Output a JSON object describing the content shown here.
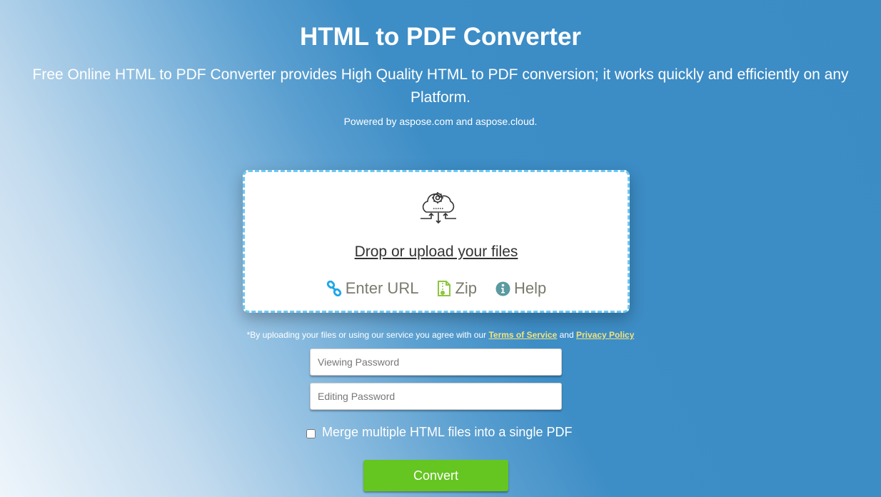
{
  "header": {
    "title": "HTML to PDF Converter",
    "subtitle": "Free Online HTML to PDF Converter provides High Quality HTML to PDF conversion; it works quickly and efficiently on any Platform.",
    "powered_by": "Powered by aspose.com and aspose.cloud."
  },
  "dropzone": {
    "icon": "cloud-upload-gear-icon",
    "upload_label": "Drop or upload your files",
    "options": [
      {
        "label": "Enter URL",
        "icon": "link-icon",
        "color": "#1ea7e8"
      },
      {
        "label": "Zip",
        "icon": "zip-file-icon",
        "color": "#8dc63f"
      },
      {
        "label": "Help",
        "icon": "info-icon",
        "color": "#5b9aa0"
      }
    ]
  },
  "terms": {
    "prefix": "*By uploading your files or using our service you agree with our",
    "terms_link": "Terms of Service",
    "and": "and",
    "privacy_link": "Privacy Policy"
  },
  "form": {
    "viewing_password_placeholder": "Viewing Password",
    "viewing_password_value": "",
    "editing_password_placeholder": "Editing Password",
    "editing_password_value": "",
    "merge_label": "Merge multiple HTML files into a single PDF",
    "merge_checked": false,
    "convert_label": "Convert"
  },
  "colors": {
    "accent_green": "#65c521",
    "link_yellow": "#f3e27a",
    "dropzone_border": "#6ec7ef",
    "background_blue": "#3b8bc5"
  }
}
